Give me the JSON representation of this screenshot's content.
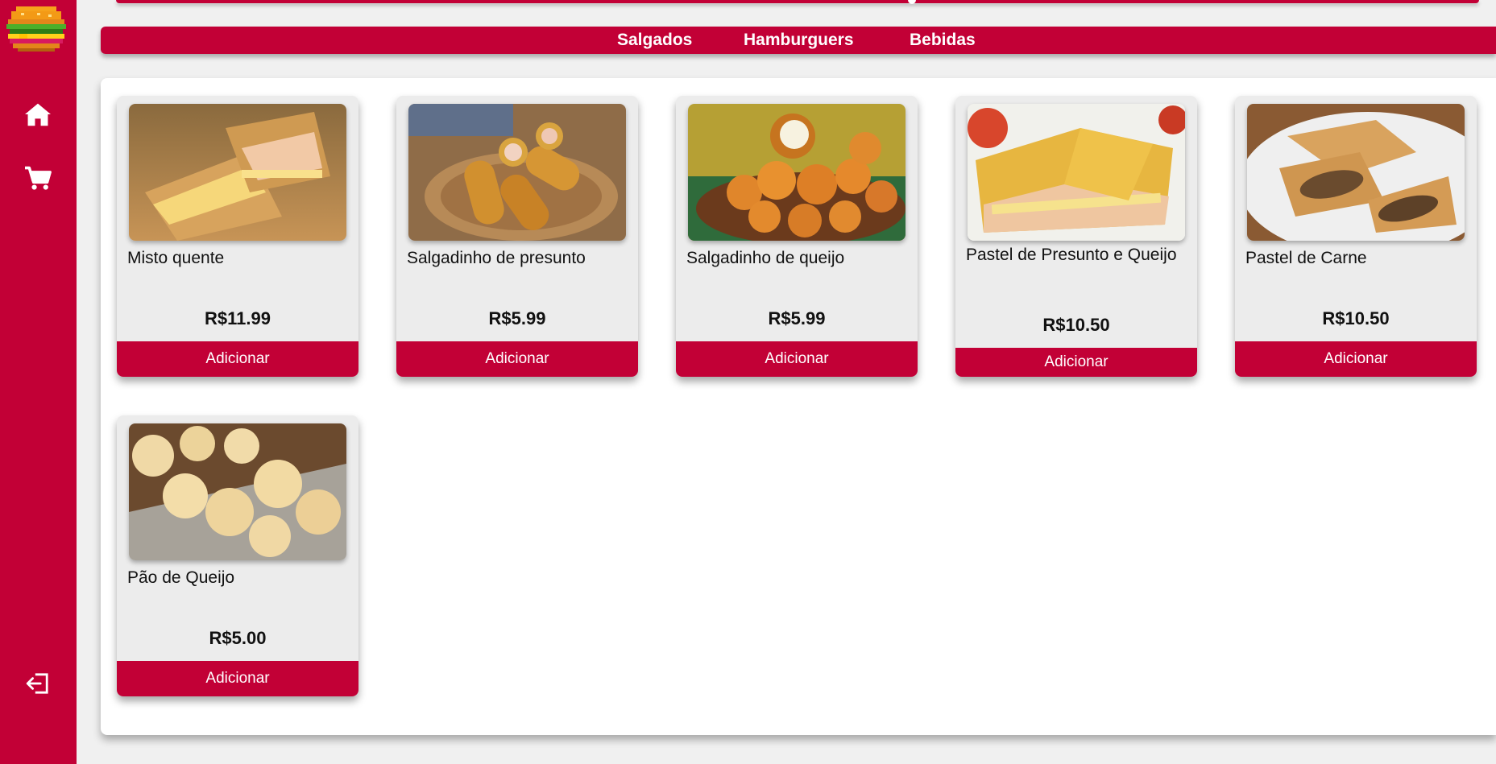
{
  "sidebar": {
    "logo_icon": "pixel-burger-logo",
    "items": [
      {
        "icon": "home-icon"
      },
      {
        "icon": "cart-icon"
      },
      {
        "icon": "logout-icon"
      }
    ]
  },
  "categories": [
    "Salgados",
    "Hamburguers",
    "Bebidas"
  ],
  "colors": {
    "accent": "#c20036",
    "card_bg": "#ececec",
    "page_bg": "#f0f0f0"
  },
  "products": [
    {
      "name": "Misto quente",
      "price": "R$11.99",
      "button": "Adicionar",
      "image_icon": "grilled-sandwich-photo"
    },
    {
      "name": "Salgadinho de presunto",
      "price": "R$5.99",
      "button": "Adicionar",
      "image_icon": "croquette-photo"
    },
    {
      "name": "Salgadinho de queijo",
      "price": "R$5.99",
      "button": "Adicionar",
      "image_icon": "cheese-balls-photo"
    },
    {
      "name": "Pastel de Presunto e Queijo",
      "price": "R$10.50",
      "button": "Adicionar",
      "image_icon": "pastel-ham-cheese-photo"
    },
    {
      "name": "Pastel de Carne",
      "price": "R$10.50",
      "button": "Adicionar",
      "image_icon": "pastel-meat-photo"
    },
    {
      "name": "Pão de Queijo",
      "price": "R$5.00",
      "button": "Adicionar",
      "image_icon": "cheese-bread-photo"
    }
  ]
}
